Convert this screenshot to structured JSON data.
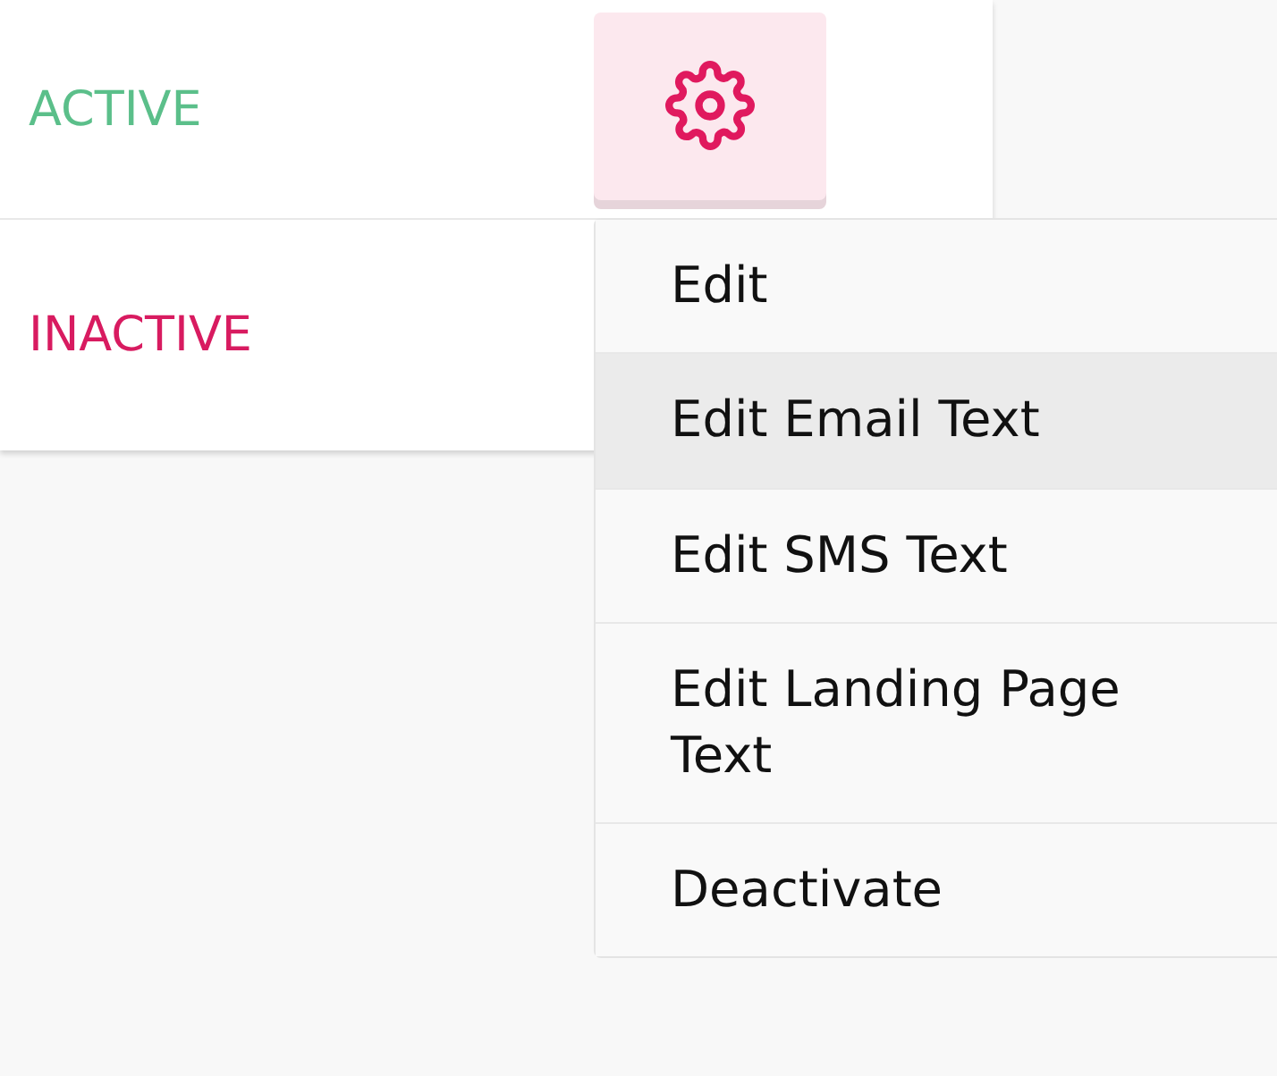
{
  "rows": [
    {
      "status": "ACTIVE",
      "color": "#5bbf8a",
      "button": {
        "kind": "settings"
      }
    },
    {
      "status": "INACTIVE",
      "color": "#d81b60"
    }
  ],
  "menu": {
    "items": [
      {
        "label": "Edit",
        "selected": false
      },
      {
        "label": "Edit Email Text",
        "selected": true
      },
      {
        "label": "Edit SMS Text",
        "selected": false
      },
      {
        "label": "Edit Landing Page Text",
        "selected": false
      },
      {
        "label": "Deactivate",
        "selected": false
      }
    ]
  }
}
